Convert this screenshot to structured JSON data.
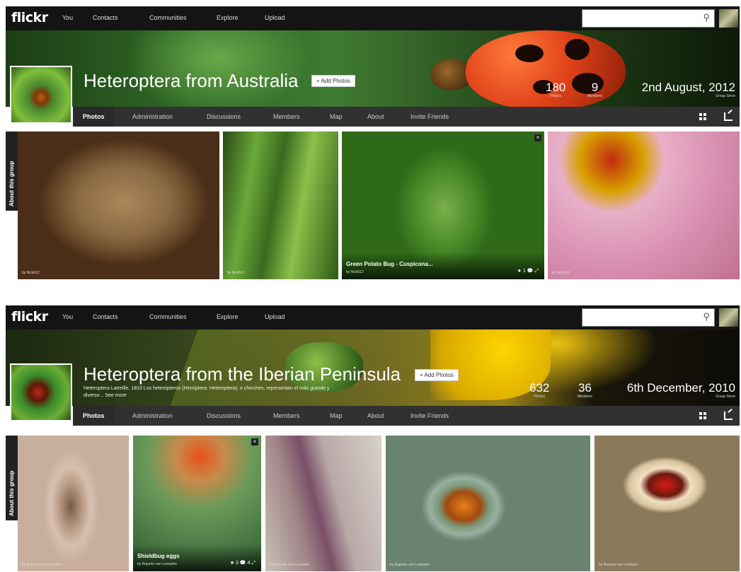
{
  "nav": {
    "logo": "flickr",
    "items": [
      "You",
      "Contacts",
      "Communities",
      "Explore",
      "Upload"
    ]
  },
  "groups": [
    {
      "title": "Heteroptera from Australia",
      "add_photos": "+ Add Photos",
      "stats": [
        {
          "num": "180",
          "label": "Photos"
        },
        {
          "num": "9",
          "label": "Members"
        }
      ],
      "since": {
        "date": "2nd August, 2012",
        "label": "Group Since"
      },
      "tabs": [
        "Photos",
        "Administration",
        "Discussions",
        "Members",
        "Map",
        "About",
        "Invite Friends"
      ],
      "about_tab": "About this group",
      "photos": [
        {
          "byline": "by Nick612"
        },
        {
          "byline": "by Nick612"
        },
        {
          "title": "Green Potato Bug - Cuspicona...",
          "byline": "by Nick612",
          "stats": "★ 1  💬  ⤢"
        },
        {
          "byline": "by Nick612"
        }
      ]
    },
    {
      "title": "Heteroptera from the Iberian Peninsula",
      "add_photos": "+ Add Photos",
      "description": "Heteroptera Latreille, 1810 Los heterópteros (Hemiptera: Heteroptera), o chinches, representan el más grande y diverso... See more",
      "stats": [
        {
          "num": "632",
          "label": "Photos"
        },
        {
          "num": "36",
          "label": "Members"
        }
      ],
      "since": {
        "date": "6th December, 2010",
        "label": "Group Since"
      },
      "tabs": [
        "Photos",
        "Administration",
        "Discussions",
        "Members",
        "Map",
        "About",
        "Invite Friends"
      ],
      "about_tab": "About this group",
      "photos": [
        {
          "byline": "by Ruperto van Lomashe"
        },
        {
          "title": "Shieldbug eggs",
          "byline": "by Ruperto van Lomashe",
          "stats": "★ 3  💬 4  ⤢"
        },
        {
          "byline": "by Ruperto van Lomashe"
        },
        {
          "byline": "by Ruperto van Lomashe"
        },
        {
          "byline": "by Ruperto van Lomashe"
        }
      ]
    }
  ]
}
